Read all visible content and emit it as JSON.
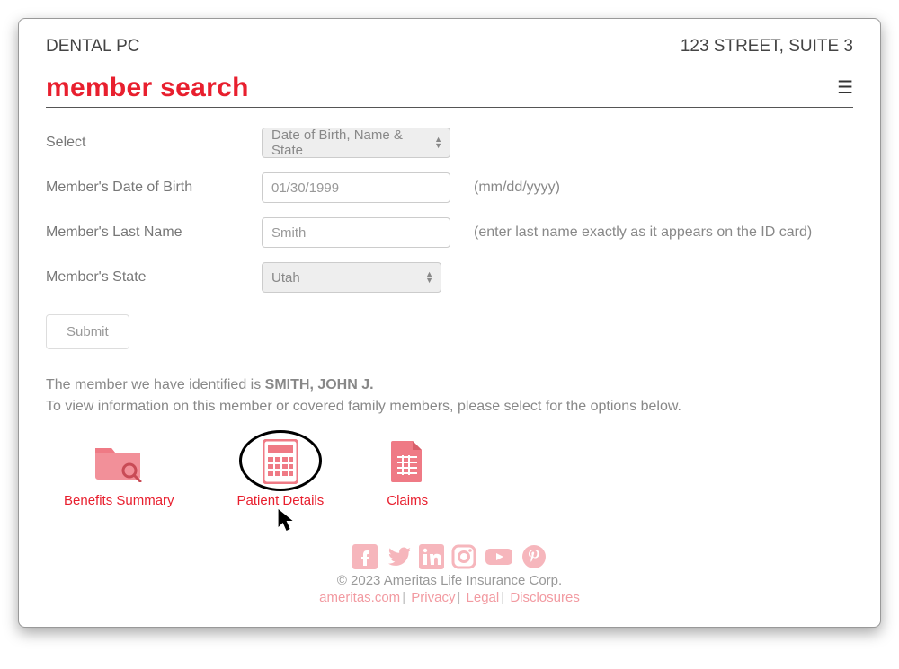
{
  "header": {
    "left": "DENTAL PC",
    "right": "123 STREET, SUITE 3"
  },
  "page_title": "member search",
  "form": {
    "select_label": "Select",
    "select_value": "Date of Birth, Name & State",
    "dob_label": "Member's Date of Birth",
    "dob_value": "01/30/1999",
    "dob_hint": "(mm/dd/yyyy)",
    "lastname_label": "Member's Last Name",
    "lastname_value": "Smith",
    "lastname_hint": "(enter last name exactly as it appears on the ID card)",
    "state_label": "Member's State",
    "state_value": "Utah",
    "submit_label": "Submit"
  },
  "results": {
    "prefix": "The member we have identified is ",
    "member_name": "SMITH, JOHN J.",
    "suffix": "",
    "line2": "To view information on this member or covered family members, please select for the options below."
  },
  "tiles": {
    "benefits": "Benefits Summary",
    "patient_details": "Patient Details",
    "claims": "Claims"
  },
  "footer": {
    "copyright": "© 2023 Ameritas Life Insurance Corp.",
    "links": {
      "site": "ameritas.com",
      "privacy": "Privacy",
      "legal": "Legal",
      "disclosures": "Disclosures"
    }
  }
}
